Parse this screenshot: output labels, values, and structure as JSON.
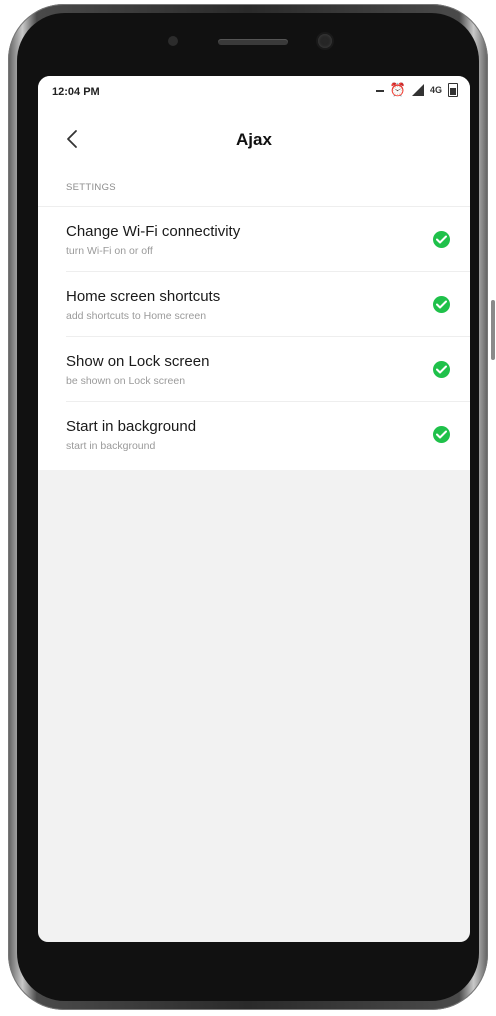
{
  "status_bar": {
    "time": "12:04 PM",
    "network": "4G"
  },
  "header": {
    "title": "Ajax",
    "back_icon": "chevron-left-icon"
  },
  "settings": {
    "section_label": "SETTINGS",
    "items": [
      {
        "title": "Change Wi-Fi connectivity",
        "subtitle": "turn Wi-Fi on or off",
        "status_icon": "check-circle-icon",
        "enabled": true
      },
      {
        "title": "Home screen shortcuts",
        "subtitle": "add shortcuts to Home screen",
        "status_icon": "check-circle-icon",
        "enabled": true
      },
      {
        "title": "Show on Lock screen",
        "subtitle": "be shown on Lock screen",
        "status_icon": "check-circle-icon",
        "enabled": true
      },
      {
        "title": "Start in background",
        "subtitle": "start in background",
        "status_icon": "check-circle-icon",
        "enabled": true
      }
    ]
  },
  "colors": {
    "accent_green": "#1fc14a",
    "background": "#f2f2f2",
    "panel": "#ffffff"
  }
}
